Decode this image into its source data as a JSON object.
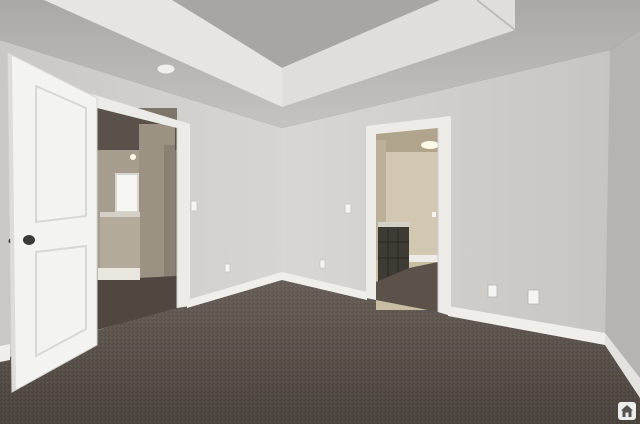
{
  "photo": {
    "subject": "empty-bedroom",
    "colors": {
      "wall": "#d2d1cd",
      "wall_shade": "#c2c1bd",
      "ceiling": "#bfbebb",
      "carpet": "#5e564f",
      "door": "#f3f3f1",
      "trim": "#ecebe8",
      "cabinet": "#3e3a34"
    }
  },
  "watermark": {
    "icon": "house-logo-icon"
  }
}
